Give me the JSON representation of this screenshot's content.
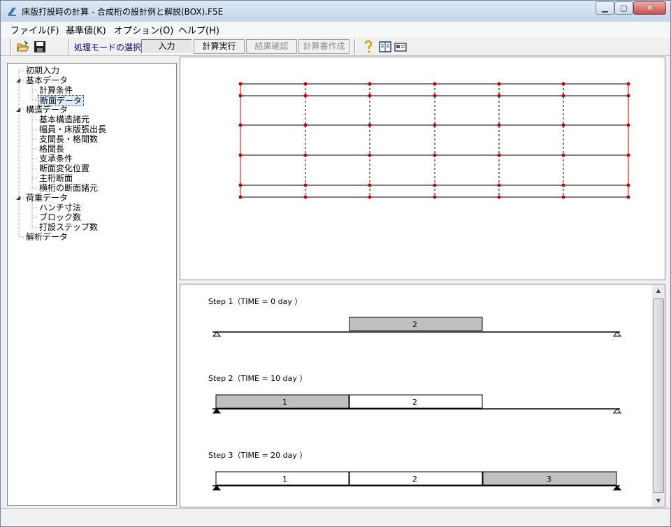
{
  "window": {
    "title": "床版打設時の計算 - 合成桁の設計例と解説(BOX).F5E",
    "minimize": "▁",
    "maximize": "▢",
    "close": "✕"
  },
  "menu": [
    "ファイル(F)",
    "基準値(K)",
    "オプション(O)",
    "ヘルプ(H)"
  ],
  "toolbar": {
    "open_icon": "folder-open-icon",
    "save_icon": "floppy-save-icon",
    "mode_label": "処理モードの選択",
    "modes": [
      {
        "label": "入力",
        "state": "active"
      },
      {
        "label": "計算実行",
        "state": "enabled"
      },
      {
        "label": "結果確認",
        "state": "disabled"
      },
      {
        "label": "計算書作成",
        "state": "disabled"
      }
    ],
    "help_icon": "question-mark-icon",
    "book_icon": "book-icon",
    "id_card_icon": "id-card-icon"
  },
  "tree": [
    {
      "label": "初期入力",
      "level": 0
    },
    {
      "label": "基本データ",
      "level": 0,
      "expanded": true
    },
    {
      "label": "計算条件",
      "level": 1
    },
    {
      "label": "断面データ",
      "level": 1,
      "selected": true
    },
    {
      "label": "構造データ",
      "level": 0,
      "expanded": true
    },
    {
      "label": "基本構造諸元",
      "level": 1
    },
    {
      "label": "幅員・床版張出長",
      "level": 1
    },
    {
      "label": "支間長・格間数",
      "level": 1
    },
    {
      "label": "格間長",
      "level": 1
    },
    {
      "label": "支承条件",
      "level": 1
    },
    {
      "label": "断面変化位置",
      "level": 1
    },
    {
      "label": "主桁断面",
      "level": 1
    },
    {
      "label": "横桁の断面諸元",
      "level": 1
    },
    {
      "label": "荷重データ",
      "level": 0,
      "expanded": true
    },
    {
      "label": "ハンチ寸法",
      "level": 1
    },
    {
      "label": "ブロック数",
      "level": 1
    },
    {
      "label": "打設ステップ数",
      "level": 1
    },
    {
      "label": "解析データ",
      "level": 0
    }
  ],
  "steps": [
    {
      "label": "Step 1（TIME = 0 day ）",
      "blocks": [
        {
          "num": "2",
          "gray": true
        }
      ]
    },
    {
      "label": "Step 2（TIME = 10 day ）",
      "blocks": [
        {
          "num": "1",
          "gray": true
        },
        {
          "num": "2",
          "gray": false
        }
      ]
    },
    {
      "label": "Step 3（TIME = 20 day ）",
      "blocks": [
        {
          "num": "1",
          "gray": false
        },
        {
          "num": "2",
          "gray": false
        },
        {
          "num": "3",
          "gray": true
        }
      ]
    }
  ],
  "colors": {
    "grid_red": "#cc0000",
    "block_gray": "#c0c0c0"
  }
}
